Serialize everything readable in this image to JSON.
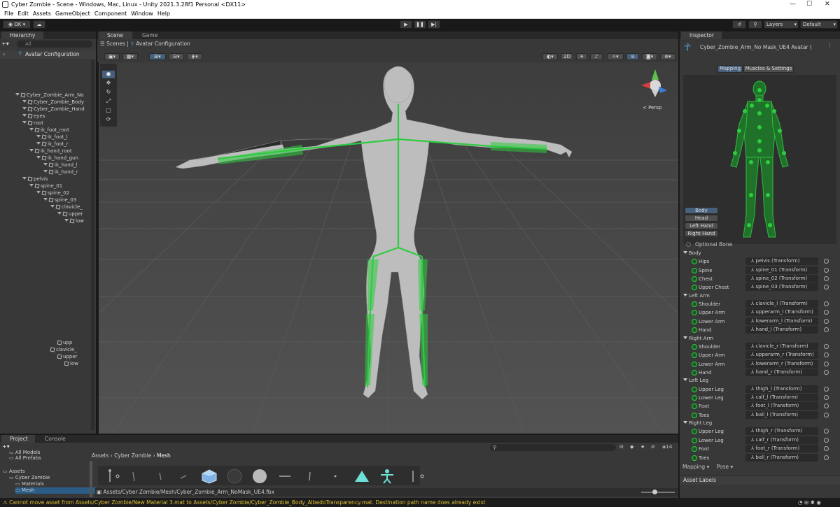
{
  "window": {
    "title": "Cyber Zombie - Scene - Windows, Mac, Linux - Unity 2021.3.28f1 Personal <DX11>"
  },
  "menu": [
    "File",
    "Edit",
    "Assets",
    "GameObject",
    "Component",
    "Window",
    "Help"
  ],
  "toolbar": {
    "account": "OK",
    "layers": "Layers",
    "layout": "Default"
  },
  "hierarchy": {
    "tab": "Hierarchy",
    "search_placeholder": "All",
    "root": "Avatar Configuration",
    "items": [
      {
        "label": "Cyber_Zombie_Arm_No",
        "depth": 0
      },
      {
        "label": "Cyber_Zombie_Body",
        "depth": 1
      },
      {
        "label": "Cyber_Zombie_Hand",
        "depth": 1
      },
      {
        "label": "eyes",
        "depth": 1
      },
      {
        "label": "root",
        "depth": 1
      },
      {
        "label": "ik_foot_root",
        "depth": 2
      },
      {
        "label": "ik_foot_l",
        "depth": 3
      },
      {
        "label": "ik_foot_r",
        "depth": 3
      },
      {
        "label": "ik_hand_root",
        "depth": 2
      },
      {
        "label": "ik_hand_gun",
        "depth": 3
      },
      {
        "label": "ik_hand_l",
        "depth": 4
      },
      {
        "label": "ik_hand_r",
        "depth": 4
      },
      {
        "label": "pelvis",
        "depth": 1
      },
      {
        "label": "spine_01",
        "depth": 2
      },
      {
        "label": "spine_02",
        "depth": 3
      },
      {
        "label": "spine_03",
        "depth": 4
      },
      {
        "label": "clavicle_",
        "depth": 5
      },
      {
        "label": "upper",
        "depth": 6
      },
      {
        "label": "low",
        "depth": 7
      }
    ],
    "bottom_items": [
      {
        "label": "upp",
        "depth": 6
      },
      {
        "label": "clavicle_",
        "depth": 5
      },
      {
        "label": "upper",
        "depth": 6
      },
      {
        "label": "low",
        "depth": 7
      }
    ]
  },
  "scene": {
    "tabs": [
      "Scene",
      "Game"
    ],
    "breadcrumb_root": "Scenes",
    "breadcrumb_current": "Avatar Configuration",
    "mode_2d": "2D",
    "gizmo_label": "< Persp"
  },
  "inspector": {
    "tab": "Inspector",
    "object_name": "Cyber_Zombie_Arm_No Mask_UE4 Avatar (",
    "tabs": [
      "Mapping",
      "Muscles & Settings"
    ],
    "body_buttons": [
      "Body",
      "Head",
      "Left Hand",
      "Right Hand"
    ],
    "optional_bone": "Optional Bone",
    "groups": [
      {
        "name": "Body",
        "rows": [
          {
            "label": "Hips",
            "value": "pelvis (Transform)"
          },
          {
            "label": "Spine",
            "value": "spine_01 (Transform)"
          },
          {
            "label": "Chest",
            "value": "spine_02 (Transform)"
          },
          {
            "label": "Upper Chest",
            "value": "spine_03 (Transform)"
          }
        ]
      },
      {
        "name": "Left Arm",
        "rows": [
          {
            "label": "Shoulder",
            "value": "clavicle_l (Transform)"
          },
          {
            "label": "Upper Arm",
            "value": "upperarm_l (Transform)"
          },
          {
            "label": "Lower Arm",
            "value": "lowerarm_l (Transform)"
          },
          {
            "label": "Hand",
            "value": "hand_l (Transform)"
          }
        ]
      },
      {
        "name": "Right Arm",
        "rows": [
          {
            "label": "Shoulder",
            "value": "clavicle_r (Transform)"
          },
          {
            "label": "Upper Arm",
            "value": "upperarm_r (Transform)"
          },
          {
            "label": "Lower Arm",
            "value": "lowerarm_r (Transform)"
          },
          {
            "label": "Hand",
            "value": "hand_r (Transform)"
          }
        ]
      },
      {
        "name": "Left Leg",
        "rows": [
          {
            "label": "Upper Leg",
            "value": "thigh_l (Transform)"
          },
          {
            "label": "Lower Leg",
            "value": "calf_l (Transform)"
          },
          {
            "label": "Foot",
            "value": "foot_l (Transform)"
          },
          {
            "label": "Toes",
            "value": "ball_l (Transform)"
          }
        ]
      },
      {
        "name": "Right Leg",
        "rows": [
          {
            "label": "Upper Leg",
            "value": "thigh_r (Transform)"
          },
          {
            "label": "Lower Leg",
            "value": "calf_r (Transform)"
          },
          {
            "label": "Foot",
            "value": "foot_r (Transform)"
          },
          {
            "label": "Toes",
            "value": "ball_r (Transform)"
          }
        ]
      }
    ],
    "mapping_menu": "Mapping",
    "pose_menu": "Pose",
    "asset_labels": "Asset Labels"
  },
  "project": {
    "tabs": [
      "Project",
      "Console"
    ],
    "tree": [
      {
        "label": "All Models",
        "depth": 1
      },
      {
        "label": "All Prefabs",
        "depth": 1
      },
      {
        "label": "Assets",
        "depth": 0
      },
      {
        "label": "Cyber Zombie",
        "depth": 1
      },
      {
        "label": "Materials",
        "depth": 2
      },
      {
        "label": "Mesh",
        "depth": 2
      }
    ],
    "breadcrumb": [
      "Assets",
      "Cyber Zombie",
      "Mesh"
    ],
    "selected_path": "Assets/Cyber Zombie/Mesh/Cyber_Zombie_Arm_NoMask_UE4.fbx",
    "visible_count": "14"
  },
  "status": {
    "message": "Cannot move asset from Assets/Cyber Zombie/New Material 3.mat to Assets/Cyber Zombie/Cyber_Zombie_Body_AlbedoTransparency.mat. Destination path name does already exist"
  },
  "colors": {
    "accent": "#46607c",
    "bone_green": "#2ecc40",
    "warning": "#e0c030"
  }
}
